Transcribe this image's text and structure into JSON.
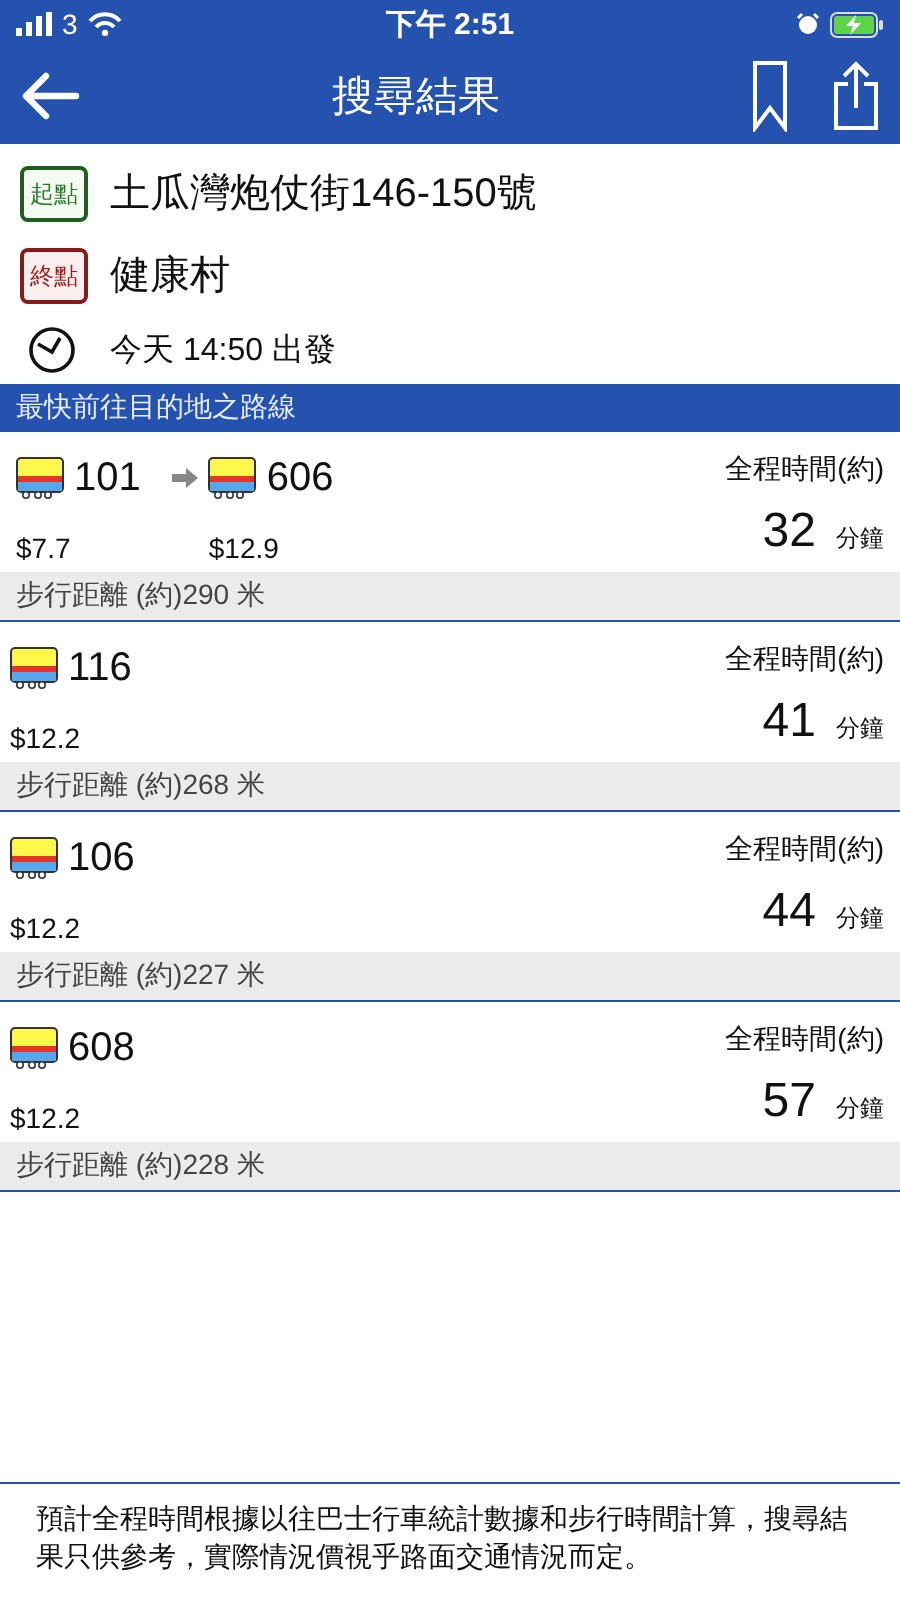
{
  "status_bar": {
    "carrier": "3",
    "time": "下午 2:51",
    "battery_charging": true
  },
  "nav": {
    "title": "搜尋結果"
  },
  "trip": {
    "origin_tag": "起點",
    "origin": "土瓜灣炮仗街146-150號",
    "destination_tag": "終點",
    "destination": "健康村",
    "departure": "今天 14:50 出發"
  },
  "section_title": "最快前往目的地之路線",
  "routes": [
    {
      "legs": [
        {
          "route": "101",
          "fare": "$7.7"
        },
        {
          "route": "606",
          "fare": "$12.9"
        }
      ],
      "time_label": "全程時間(約)",
      "minutes": "32",
      "unit": "分鐘",
      "walk": "步行距離 (約)290 米"
    },
    {
      "legs": [
        {
          "route": "116",
          "fare": "$12.2"
        }
      ],
      "time_label": "全程時間(約)",
      "minutes": "41",
      "unit": "分鐘",
      "walk": "步行距離 (約)268 米"
    },
    {
      "legs": [
        {
          "route": "106",
          "fare": "$12.2"
        }
      ],
      "time_label": "全程時間(約)",
      "minutes": "44",
      "unit": "分鐘",
      "walk": "步行距離 (約)227 米"
    },
    {
      "legs": [
        {
          "route": "608",
          "fare": "$12.2"
        }
      ],
      "time_label": "全程時間(約)",
      "minutes": "57",
      "unit": "分鐘",
      "walk": "步行距離 (約)228 米"
    }
  ],
  "footer_note": "預計全程時間根據以往巴士行車統計數據和步行時間計算，搜尋結果只供參考，實際情況價視乎路面交通情況而定。"
}
